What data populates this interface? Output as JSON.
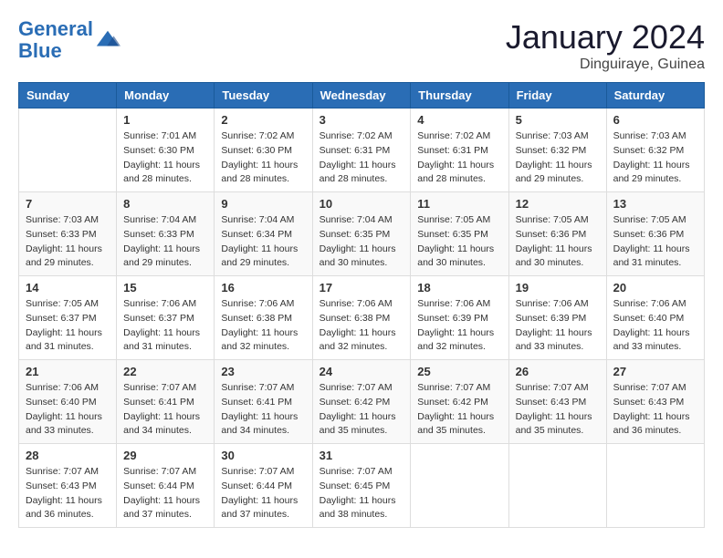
{
  "header": {
    "logo_line1": "General",
    "logo_line2": "Blue",
    "month": "January 2024",
    "location": "Dinguiraye, Guinea"
  },
  "weekdays": [
    "Sunday",
    "Monday",
    "Tuesday",
    "Wednesday",
    "Thursday",
    "Friday",
    "Saturday"
  ],
  "weeks": [
    [
      {
        "day": "",
        "info": ""
      },
      {
        "day": "1",
        "info": "Sunrise: 7:01 AM\nSunset: 6:30 PM\nDaylight: 11 hours\nand 28 minutes."
      },
      {
        "day": "2",
        "info": "Sunrise: 7:02 AM\nSunset: 6:30 PM\nDaylight: 11 hours\nand 28 minutes."
      },
      {
        "day": "3",
        "info": "Sunrise: 7:02 AM\nSunset: 6:31 PM\nDaylight: 11 hours\nand 28 minutes."
      },
      {
        "day": "4",
        "info": "Sunrise: 7:02 AM\nSunset: 6:31 PM\nDaylight: 11 hours\nand 28 minutes."
      },
      {
        "day": "5",
        "info": "Sunrise: 7:03 AM\nSunset: 6:32 PM\nDaylight: 11 hours\nand 29 minutes."
      },
      {
        "day": "6",
        "info": "Sunrise: 7:03 AM\nSunset: 6:32 PM\nDaylight: 11 hours\nand 29 minutes."
      }
    ],
    [
      {
        "day": "7",
        "info": "Sunrise: 7:03 AM\nSunset: 6:33 PM\nDaylight: 11 hours\nand 29 minutes."
      },
      {
        "day": "8",
        "info": "Sunrise: 7:04 AM\nSunset: 6:33 PM\nDaylight: 11 hours\nand 29 minutes."
      },
      {
        "day": "9",
        "info": "Sunrise: 7:04 AM\nSunset: 6:34 PM\nDaylight: 11 hours\nand 29 minutes."
      },
      {
        "day": "10",
        "info": "Sunrise: 7:04 AM\nSunset: 6:35 PM\nDaylight: 11 hours\nand 30 minutes."
      },
      {
        "day": "11",
        "info": "Sunrise: 7:05 AM\nSunset: 6:35 PM\nDaylight: 11 hours\nand 30 minutes."
      },
      {
        "day": "12",
        "info": "Sunrise: 7:05 AM\nSunset: 6:36 PM\nDaylight: 11 hours\nand 30 minutes."
      },
      {
        "day": "13",
        "info": "Sunrise: 7:05 AM\nSunset: 6:36 PM\nDaylight: 11 hours\nand 31 minutes."
      }
    ],
    [
      {
        "day": "14",
        "info": "Sunrise: 7:05 AM\nSunset: 6:37 PM\nDaylight: 11 hours\nand 31 minutes."
      },
      {
        "day": "15",
        "info": "Sunrise: 7:06 AM\nSunset: 6:37 PM\nDaylight: 11 hours\nand 31 minutes."
      },
      {
        "day": "16",
        "info": "Sunrise: 7:06 AM\nSunset: 6:38 PM\nDaylight: 11 hours\nand 32 minutes."
      },
      {
        "day": "17",
        "info": "Sunrise: 7:06 AM\nSunset: 6:38 PM\nDaylight: 11 hours\nand 32 minutes."
      },
      {
        "day": "18",
        "info": "Sunrise: 7:06 AM\nSunset: 6:39 PM\nDaylight: 11 hours\nand 32 minutes."
      },
      {
        "day": "19",
        "info": "Sunrise: 7:06 AM\nSunset: 6:39 PM\nDaylight: 11 hours\nand 33 minutes."
      },
      {
        "day": "20",
        "info": "Sunrise: 7:06 AM\nSunset: 6:40 PM\nDaylight: 11 hours\nand 33 minutes."
      }
    ],
    [
      {
        "day": "21",
        "info": "Sunrise: 7:06 AM\nSunset: 6:40 PM\nDaylight: 11 hours\nand 33 minutes."
      },
      {
        "day": "22",
        "info": "Sunrise: 7:07 AM\nSunset: 6:41 PM\nDaylight: 11 hours\nand 34 minutes."
      },
      {
        "day": "23",
        "info": "Sunrise: 7:07 AM\nSunset: 6:41 PM\nDaylight: 11 hours\nand 34 minutes."
      },
      {
        "day": "24",
        "info": "Sunrise: 7:07 AM\nSunset: 6:42 PM\nDaylight: 11 hours\nand 35 minutes."
      },
      {
        "day": "25",
        "info": "Sunrise: 7:07 AM\nSunset: 6:42 PM\nDaylight: 11 hours\nand 35 minutes."
      },
      {
        "day": "26",
        "info": "Sunrise: 7:07 AM\nSunset: 6:43 PM\nDaylight: 11 hours\nand 35 minutes."
      },
      {
        "day": "27",
        "info": "Sunrise: 7:07 AM\nSunset: 6:43 PM\nDaylight: 11 hours\nand 36 minutes."
      }
    ],
    [
      {
        "day": "28",
        "info": "Sunrise: 7:07 AM\nSunset: 6:43 PM\nDaylight: 11 hours\nand 36 minutes."
      },
      {
        "day": "29",
        "info": "Sunrise: 7:07 AM\nSunset: 6:44 PM\nDaylight: 11 hours\nand 37 minutes."
      },
      {
        "day": "30",
        "info": "Sunrise: 7:07 AM\nSunset: 6:44 PM\nDaylight: 11 hours\nand 37 minutes."
      },
      {
        "day": "31",
        "info": "Sunrise: 7:07 AM\nSunset: 6:45 PM\nDaylight: 11 hours\nand 38 minutes."
      },
      {
        "day": "",
        "info": ""
      },
      {
        "day": "",
        "info": ""
      },
      {
        "day": "",
        "info": ""
      }
    ]
  ]
}
